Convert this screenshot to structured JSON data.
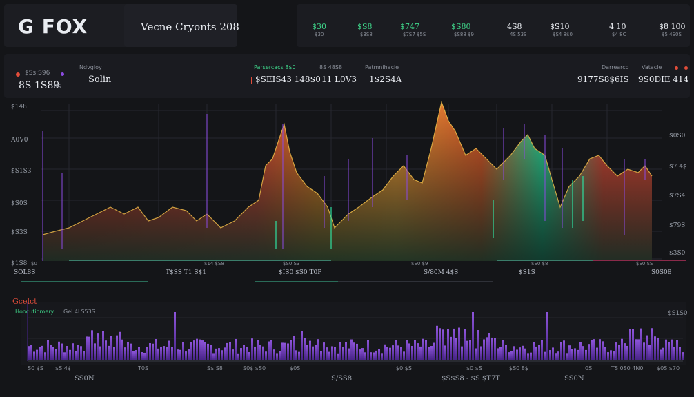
{
  "app": {
    "logo": "G FOX",
    "title": "Vecne Cryonts 208"
  },
  "tickers": [
    {
      "value": "$30",
      "label": "$30",
      "color": "#3fd58a"
    },
    {
      "value": "$S8",
      "label": "$3S8",
      "color": "#3fd58a"
    },
    {
      "value": "$747",
      "label": "$7S7 $5S",
      "color": "#3fd58a"
    },
    {
      "value": "$S80",
      "label": "$S88 $9",
      "color": "#3fd58a"
    },
    {
      "value": "4S8",
      "label": "4S 53S",
      "color": "#e9ecf1"
    },
    {
      "value": "$S10",
      "label": "$S4 8$0",
      "color": "#e9ecf1"
    },
    {
      "value": "4 10",
      "label": "$4 8C",
      "color": "#e9ecf1"
    },
    {
      "value": "$8 100",
      "label": "$5 4S0S",
      "color": "#e9ecf1"
    }
  ],
  "summary": {
    "left_label": "$Ss:S96",
    "left_value": "8S 1S89",
    "left_unit": "8S",
    "pair_label": "Ndvgloy",
    "pair_value": "Solin",
    "stat1_label": "Parsercacs 8$0",
    "stat1_value": "$SEIS43 148$0",
    "stat2_label": "8S 48S8",
    "stat2_value": "11 L0V3",
    "stat3_label": "Patmnihacie",
    "stat3_value": "1$2S4A",
    "right1_label": "Darrearco",
    "right1_value": "9177S8$6IS",
    "right2_label": "Vatacle",
    "right2_value": "9S0DIE 414"
  },
  "main_chart": {
    "y_left": [
      "$148",
      "A0V0",
      "$S1S3",
      "$S0S",
      "$S3S",
      "$1S8"
    ],
    "y_right": [
      "$0S0",
      "$7 4$",
      "$7S4",
      "$79S",
      "$3S0"
    ],
    "x_labels": [
      "$0",
      "$14 $S8",
      "$S0 S3",
      "$S0 $9",
      "$S0 $8",
      "$S0 $S"
    ],
    "sub_labels": [
      "SOL8S",
      "T$SS  T1 S$1",
      "$IS0 $S0 T0P",
      "S/80M 4$S",
      "$S1S",
      "S0S08"
    ]
  },
  "volume": {
    "title": "Gcelct",
    "subtitle_left": "Hoocutiomery",
    "subtitle_right": "Gel 4LS53S",
    "y_right": "$S1S0",
    "x_labels": [
      "S0 $S",
      "$S 4$",
      "T0S",
      "S$ S8",
      "S0$ $S0",
      "$0S",
      "$0 $S",
      "$0 $S",
      "$S0 8$",
      "0S",
      "TS 0S0 4N0",
      "$0S $70"
    ],
    "bottom_labels": [
      "SS0N",
      "S/SS8",
      "$S$S8  -  $S $T7T",
      "SS0N"
    ]
  },
  "colors": {
    "bg": "#141518",
    "panel": "#1b1c21",
    "green": "#3fd58a",
    "red": "#e24d3a",
    "orange": "#f08a2a",
    "purple": "#8b4be0",
    "accent_line": "#2fe0a0"
  }
}
